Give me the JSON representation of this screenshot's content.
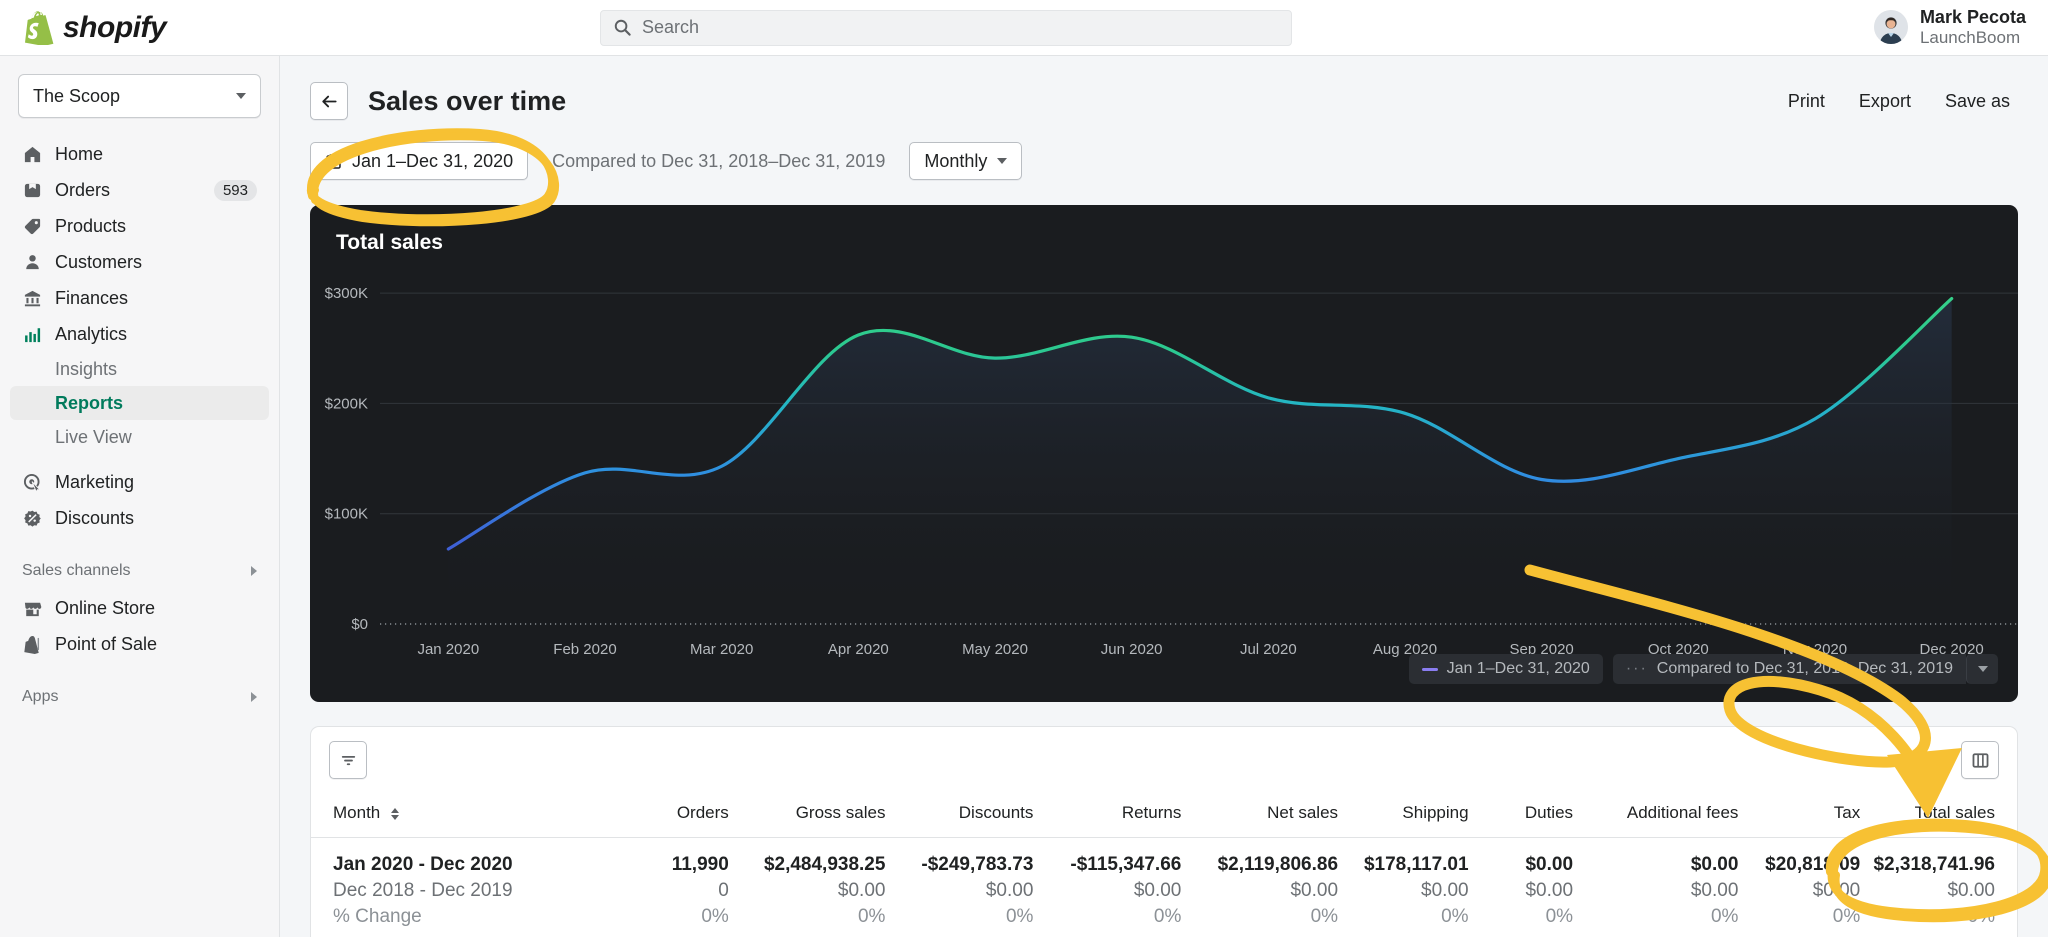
{
  "topbar": {
    "logo_text": "shopify",
    "logo_icon": "shopify-bag-icon",
    "search_placeholder": "Search",
    "search_value": "",
    "search_icon": "search-icon",
    "user_name": "Mark Pecota",
    "user_org": "LaunchBoom"
  },
  "sidebar": {
    "store_name": "The Scoop",
    "items": [
      {
        "label": "Home",
        "icon": "home-icon",
        "badge": ""
      },
      {
        "label": "Orders",
        "icon": "orders-inbox-icon",
        "badge": "593"
      },
      {
        "label": "Products",
        "icon": "products-tag-icon",
        "badge": ""
      },
      {
        "label": "Customers",
        "icon": "customers-person-icon",
        "badge": ""
      },
      {
        "label": "Finances",
        "icon": "finances-bank-icon",
        "badge": ""
      },
      {
        "label": "Analytics",
        "icon": "analytics-bars-icon",
        "badge": ""
      }
    ],
    "analytics_children": [
      {
        "label": "Insights",
        "active": false
      },
      {
        "label": "Reports",
        "active": true
      },
      {
        "label": "Live View",
        "active": false
      }
    ],
    "items_after": [
      {
        "label": "Marketing",
        "icon": "marketing-target-icon"
      },
      {
        "label": "Discounts",
        "icon": "discounts-percent-icon"
      }
    ],
    "sales_channels_label": "Sales channels",
    "channels": [
      {
        "label": "Online Store",
        "icon": "online-store-icon"
      },
      {
        "label": "Point of Sale",
        "icon": "point-of-sale-icon"
      }
    ],
    "apps_label": "Apps"
  },
  "page": {
    "back_icon": "back-arrow-icon",
    "title": "Sales over time",
    "actions": [
      {
        "label": "Print"
      },
      {
        "label": "Export"
      },
      {
        "label": "Save as"
      }
    ],
    "date_range": "Jan 1–Dec 31, 2020",
    "date_icon": "calendar-icon",
    "compared_text": "Compared to Dec 31, 2018–Dec 31, 2019",
    "granularity": "Monthly"
  },
  "chart_data": {
    "type": "line",
    "title": "Total sales",
    "xlabel": "",
    "ylabel": "",
    "ylim": [
      0,
      320000
    ],
    "y_ticks": [
      0,
      100000,
      200000,
      300000
    ],
    "y_tick_labels": [
      "$0",
      "$100K",
      "$200K",
      "$300K"
    ],
    "grid": true,
    "legend_position": "bottom-right",
    "categories": [
      "Jan 2020",
      "Feb 2020",
      "Mar 2020",
      "Apr 2020",
      "May 2020",
      "Jun 2020",
      "Jul 2020",
      "Aug 2020",
      "Sep 2020",
      "Oct 2020",
      "Nov 2020",
      "Dec 2020"
    ],
    "series": [
      {
        "name": "Jan 1–Dec 31, 2020",
        "color": "#8a7df0",
        "style": "solid",
        "values": [
          68000,
          137000,
          143000,
          262000,
          241000,
          260000,
          205000,
          191000,
          131000,
          150000,
          186000,
          295000
        ]
      },
      {
        "name": "Compared to Dec 31, 2018–Dec 31, 2019",
        "color": "#6d7175",
        "style": "dotted",
        "values": [
          0,
          0,
          0,
          0,
          0,
          0,
          0,
          0,
          0,
          0,
          0,
          0
        ]
      }
    ]
  },
  "table": {
    "filter_icon": "filter-icon",
    "columns_icon": "columns-icon",
    "headers": [
      "Month",
      "Orders",
      "Gross sales",
      "Discounts",
      "Returns",
      "Net sales",
      "Shipping",
      "Duties",
      "Additional fees",
      "Tax",
      "Total sales"
    ],
    "sort_column": "Month",
    "rows": [
      {
        "type": "current",
        "cells": [
          "Jan 2020 - Dec 2020",
          "11,990",
          "$2,484,938.25",
          "-$249,783.73",
          "-$115,347.66",
          "$2,119,806.86",
          "$178,117.01",
          "$0.00",
          "$0.00",
          "$20,818.09",
          "$2,318,741.96"
        ]
      },
      {
        "type": "compare",
        "cells": [
          "Dec 2018 - Dec 2019",
          "0",
          "$0.00",
          "$0.00",
          "$0.00",
          "$0.00",
          "$0.00",
          "$0.00",
          "$0.00",
          "$0.00",
          "$0.00"
        ]
      },
      {
        "type": "change",
        "cells": [
          "% Change",
          "0%",
          "0%",
          "0%",
          "0%",
          "0%",
          "0%",
          "0%",
          "0%",
          "0%",
          "0%"
        ]
      }
    ]
  },
  "annotations": {
    "color": "#f7c133",
    "marks": [
      {
        "name": "date-range-circle",
        "shape": "ellipse"
      },
      {
        "name": "total-sales-arrow",
        "shape": "curved-arrow"
      },
      {
        "name": "total-sales-value-circle",
        "shape": "ellipse"
      }
    ]
  },
  "colors": {
    "accent_green": "#007b5c",
    "chart_bg": "#1a1c1f",
    "highlight": "#f7c133"
  }
}
